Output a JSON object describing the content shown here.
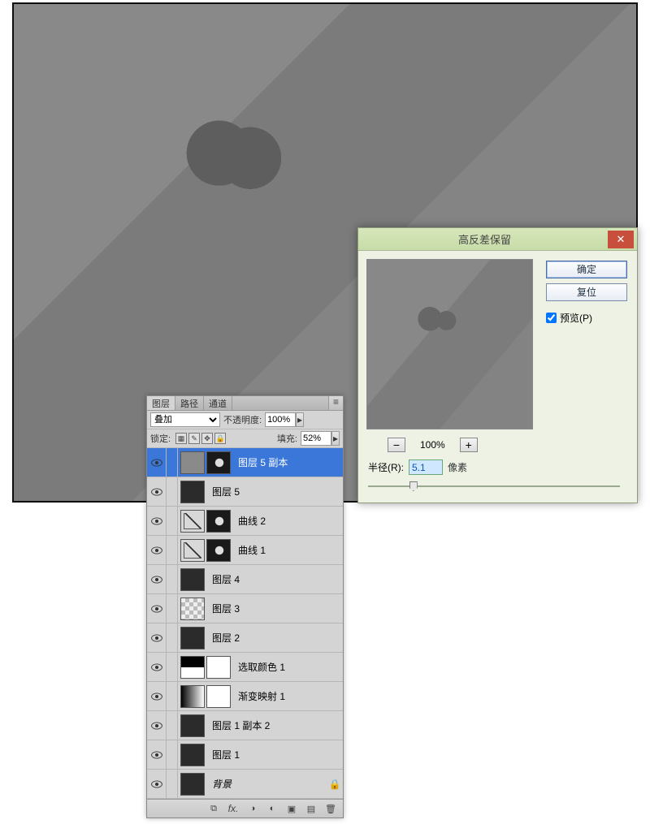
{
  "layers_panel": {
    "tabs": {
      "layers": "图层",
      "paths": "路径",
      "channels": "通道"
    },
    "blend_mode": "叠加",
    "opacity_label": "不透明度:",
    "opacity_value": "100%",
    "lock_label": "锁定:",
    "fill_label": "填充:",
    "fill_value": "52%",
    "layers": [
      {
        "name": "图层 5 副本",
        "selected": true,
        "thumbs": [
          "graylow",
          "mask"
        ]
      },
      {
        "name": "图层 5",
        "selected": false,
        "thumbs": [
          "dark"
        ]
      },
      {
        "name": "曲线 2",
        "selected": false,
        "thumbs": [
          "curves",
          "mask"
        ]
      },
      {
        "name": "曲线 1",
        "selected": false,
        "thumbs": [
          "curves",
          "mask"
        ]
      },
      {
        "name": "图层 4",
        "selected": false,
        "thumbs": [
          "dark"
        ]
      },
      {
        "name": "图层 3",
        "selected": false,
        "thumbs": [
          "checker"
        ]
      },
      {
        "name": "图层 2",
        "selected": false,
        "thumbs": [
          "dark"
        ]
      },
      {
        "name": "选取颜色 1",
        "selected": false,
        "thumbs": [
          "sel",
          "white"
        ]
      },
      {
        "name": "渐变映射 1",
        "selected": false,
        "thumbs": [
          "grad",
          "white"
        ]
      },
      {
        "name": "图层 1 副本 2",
        "selected": false,
        "thumbs": [
          "dark"
        ]
      },
      {
        "name": "图层 1",
        "selected": false,
        "thumbs": [
          "dark"
        ]
      },
      {
        "name": "背景",
        "selected": false,
        "thumbs": [
          "dark"
        ],
        "locked": true,
        "italic": true
      }
    ],
    "bottom_icons": [
      "link",
      "fx",
      "mask",
      "adjust",
      "folder",
      "new",
      "trash"
    ]
  },
  "dialog": {
    "title": "高反差保留",
    "ok": "确定",
    "reset": "复位",
    "preview_label": "预览(P)",
    "preview_checked": true,
    "zoom_value": "100%",
    "radius_label": "半径(R):",
    "radius_value": "5.1",
    "radius_unit": "像素",
    "slider_percent": 18
  }
}
